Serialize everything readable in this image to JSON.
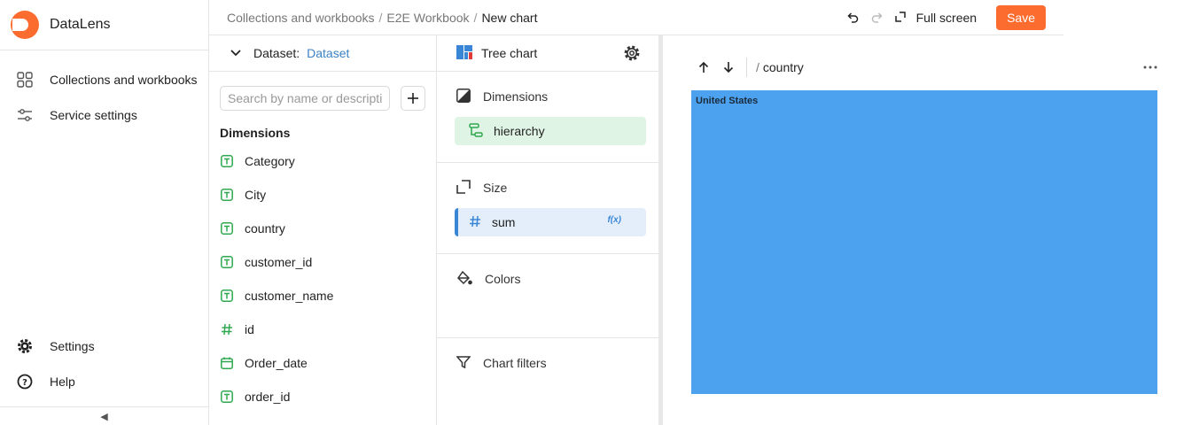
{
  "app": {
    "name": "DataLens"
  },
  "nav": {
    "items": [
      {
        "label": "Collections and workbooks",
        "icon": "grid-icon"
      },
      {
        "label": "Service settings",
        "icon": "sliders-icon"
      }
    ],
    "bottom": [
      {
        "label": "Settings",
        "icon": "gear-icon"
      },
      {
        "label": "Help",
        "icon": "help-icon"
      }
    ],
    "collapse_glyph": "◀"
  },
  "breadcrumbs": {
    "items": [
      "Collections and workbooks",
      "E2E Workbook"
    ],
    "current": "New chart",
    "separator": "/"
  },
  "toolbar": {
    "fullscreen_label": "Full screen",
    "save_label": "Save"
  },
  "dataset": {
    "label": "Dataset:",
    "value": "Dataset",
    "search_placeholder": "Search by name or description",
    "section_title": "Dimensions",
    "fields": [
      {
        "label": "Category",
        "type": "text"
      },
      {
        "label": "City",
        "type": "text"
      },
      {
        "label": "country",
        "type": "text"
      },
      {
        "label": "customer_id",
        "type": "text"
      },
      {
        "label": "customer_name",
        "type": "text"
      },
      {
        "label": "id",
        "type": "number"
      },
      {
        "label": "Order_date",
        "type": "date"
      },
      {
        "label": "order_id",
        "type": "text"
      }
    ]
  },
  "visualization": {
    "type_label": "Tree chart",
    "sections": {
      "dimensions": {
        "title": "Dimensions",
        "chip": "hierarchy"
      },
      "size": {
        "title": "Size",
        "chip": "sum",
        "chip_badge": "f(x)"
      },
      "colors": {
        "title": "Colors"
      },
      "filters": {
        "title": "Chart filters"
      }
    }
  },
  "preview": {
    "breadcrumb_sep": "/",
    "breadcrumb": "country",
    "treemap": {
      "items": [
        {
          "label": "United States",
          "share": 1.0
        }
      ],
      "color": "#4da2ef"
    }
  },
  "colors": {
    "accent": "#fc6c2f",
    "link": "#3b82c4",
    "dimension_green": "#2fa84f",
    "measure_blue": "#3a86d6"
  }
}
